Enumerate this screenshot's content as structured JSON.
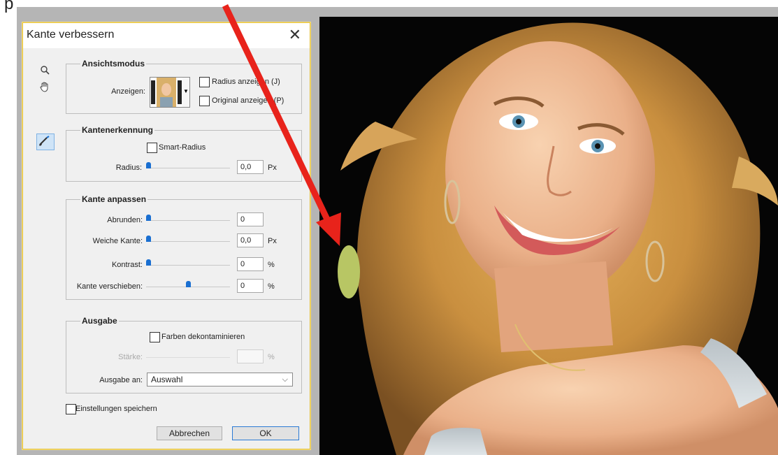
{
  "top_text": "p",
  "dialog": {
    "title": "Kante verbessern",
    "close_glyph": "✕",
    "tools": [
      "zoom-icon",
      "hand-icon",
      "refine-radius-brush-icon"
    ],
    "view_mode": {
      "legend": "Ansichtsmodus",
      "show_label": "Anzeigen:",
      "show_radius_label": "Radius anzeigen (J)",
      "show_original_label": "Original anzeigen (P)"
    },
    "edge_detection": {
      "legend": "Kantenerkennung",
      "smart_radius_label": "Smart-Radius",
      "radius_label": "Radius:",
      "radius_value": "0,0",
      "radius_unit": "Px",
      "radius_level": 0
    },
    "adjust_edge": {
      "legend": "Kante anpassen",
      "smooth_label": "Abrunden:",
      "smooth_value": "0",
      "smooth_level": 0,
      "feather_label": "Weiche Kante:",
      "feather_value": "0,0",
      "feather_unit": "Px",
      "feather_level": 0,
      "contrast_label": "Kontrast:",
      "contrast_value": "0",
      "contrast_unit": "%",
      "contrast_level": 0,
      "shift_label": "Kante verschieben:",
      "shift_value": "0",
      "shift_unit": "%",
      "shift_level": 0.5
    },
    "output": {
      "legend": "Ausgabe",
      "decontaminate_label": "Farben dekontaminieren",
      "amount_label": "Stärke:",
      "amount_unit": "%",
      "output_to_label": "Ausgabe an:",
      "output_to_value": "Auswahl"
    },
    "remember_label": "Einstellungen speichern",
    "cancel_label": "Abbrechen",
    "ok_label": "OK"
  },
  "colors": {
    "annotation_arrow": "#e8231b",
    "slider_handle": "#1a6fd1",
    "dialog_border": "#e6c23a"
  }
}
